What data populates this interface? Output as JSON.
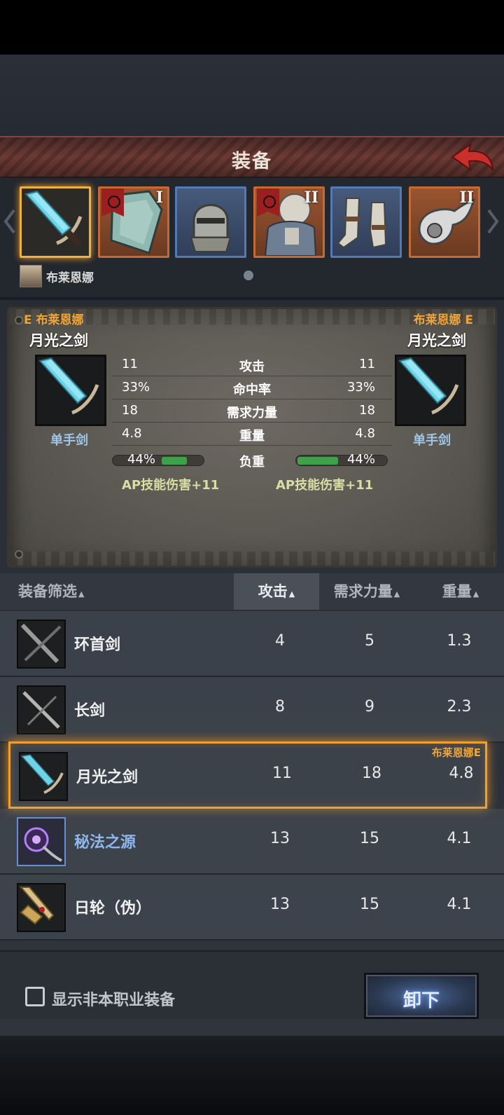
{
  "header": {
    "title": "装备"
  },
  "slots": [
    {
      "icon": "sword-icon",
      "tier": "",
      "selected": true
    },
    {
      "icon": "shield-icon",
      "tier": "I"
    },
    {
      "icon": "helmet-icon",
      "tier": ""
    },
    {
      "icon": "armor-icon",
      "tier": "II"
    },
    {
      "icon": "boots-icon",
      "tier": ""
    },
    {
      "icon": "accessory-icon",
      "tier": "II"
    }
  ],
  "owner": {
    "name": "布莱恩娜"
  },
  "compare": {
    "left_label": "E 布莱恩娜",
    "right_label": "布莱恩娜 E",
    "left_name": "月光之剑",
    "right_name": "月光之剑",
    "left_type": "单手剑",
    "right_type": "单手剑",
    "stats": [
      {
        "label": "攻击",
        "left": "11",
        "right": "11"
      },
      {
        "label": "命中率",
        "left": "33%",
        "right": "33%"
      },
      {
        "label": "需求力量",
        "left": "18",
        "right": "18"
      },
      {
        "label": "重量",
        "left": "4.8",
        "right": "4.8"
      }
    ],
    "load": {
      "label": "负重",
      "left": "44%",
      "right": "44%",
      "left_fraction": 0.44,
      "right_fraction": 0.44
    },
    "ap_left": "AP技能伤害+11",
    "ap_right": "AP技能伤害+11"
  },
  "list_header": {
    "filter": "装备筛选",
    "col1": "攻击",
    "col2": "需求力量",
    "col3": "重量",
    "sort_marker": "▲"
  },
  "items": [
    {
      "name": "环首剑",
      "attack": "4",
      "str": "5",
      "weight": "1.3"
    },
    {
      "name": "长剑",
      "attack": "8",
      "str": "9",
      "weight": "2.3"
    },
    {
      "name": "月光之剑",
      "attack": "11",
      "str": "18",
      "weight": "4.8",
      "equipped_by": "布莱恩娜E"
    },
    {
      "name": "秘法之源",
      "attack": "13",
      "str": "15",
      "weight": "4.1"
    },
    {
      "name": "日轮（伪）",
      "attack": "13",
      "str": "15",
      "weight": "4.1"
    }
  ],
  "footer": {
    "checkbox_label": "显示非本职业装备",
    "unequip_label": "卸下"
  },
  "colors": {
    "accent_orange": "#f0a438",
    "rarity_blue": "#5479b3",
    "load_green": "#3fa24a"
  }
}
